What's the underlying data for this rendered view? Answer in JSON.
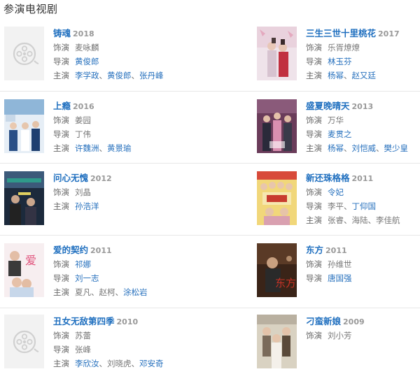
{
  "section_title": "参演电视剧",
  "labels": {
    "role": "饰演",
    "director": "导演",
    "starring": "主演"
  },
  "dramas": {
    "d0": {
      "title": "铸魂",
      "year": "2018",
      "role": [
        {
          "t": "麦咏麟",
          "l": false
        }
      ],
      "director": [
        {
          "t": "黄俊郎",
          "l": true
        }
      ],
      "starring": [
        {
          "t": "李学政",
          "l": true
        },
        {
          "t": "黄俊郎",
          "l": true
        },
        {
          "t": "张丹峰",
          "l": true
        }
      ]
    },
    "d1": {
      "title": "三生三世十里桃花",
      "year": "2017",
      "role": [
        {
          "t": "乐胥燎燎",
          "l": false
        }
      ],
      "director": [
        {
          "t": "林玉芬",
          "l": true
        }
      ],
      "starring": [
        {
          "t": "杨幂",
          "l": true
        },
        {
          "t": "赵又廷",
          "l": true
        }
      ]
    },
    "d2": {
      "title": "上瘾",
      "year": "2016",
      "role": [
        {
          "t": "姜园",
          "l": false
        }
      ],
      "director": [
        {
          "t": "丁伟",
          "l": false
        }
      ],
      "starring": [
        {
          "t": "许魏洲",
          "l": true
        },
        {
          "t": "黄景瑜",
          "l": true
        }
      ]
    },
    "d3": {
      "title": "盛夏晚晴天",
      "year": "2013",
      "role": [
        {
          "t": "万华",
          "l": false
        }
      ],
      "director": [
        {
          "t": "麦贯之",
          "l": true
        }
      ],
      "starring": [
        {
          "t": "杨幂",
          "l": true
        },
        {
          "t": "刘恺威",
          "l": true
        },
        {
          "t": "樊少皇",
          "l": true
        }
      ]
    },
    "d4": {
      "title": "问心无愧",
      "year": "2012",
      "role": [
        {
          "t": "刘晶",
          "l": false
        }
      ],
      "director": [],
      "starring": [
        {
          "t": "孙浩洋",
          "l": true
        }
      ]
    },
    "d5": {
      "title": "新还珠格格",
      "year": "2011",
      "role": [
        {
          "t": "令妃",
          "l": true
        }
      ],
      "director": [
        {
          "t": "李平",
          "l": false
        },
        {
          "t": "丁仰国",
          "l": true
        }
      ],
      "starring": [
        {
          "t": "张睿",
          "l": false
        },
        {
          "t": "海陆",
          "l": false
        },
        {
          "t": "李佳航",
          "l": false
        }
      ]
    },
    "d6": {
      "title": "爱的契约",
      "year": "2011",
      "role": [
        {
          "t": "祁娜",
          "l": true
        }
      ],
      "director": [
        {
          "t": "刘一志",
          "l": true
        }
      ],
      "starring": [
        {
          "t": "夏凡",
          "l": false
        },
        {
          "t": "赵柯",
          "l": false
        },
        {
          "t": "涂松岩",
          "l": true
        }
      ]
    },
    "d7": {
      "title": "东方",
      "year": "2011",
      "role": [
        {
          "t": "孙维世",
          "l": false
        }
      ],
      "director": [
        {
          "t": "唐国强",
          "l": true
        }
      ],
      "starring": []
    },
    "d8": {
      "title": "丑女无敌第四季",
      "year": "2010",
      "role": [
        {
          "t": "苏蕾",
          "l": false
        }
      ],
      "director": [
        {
          "t": "张峰",
          "l": false
        }
      ],
      "starring": [
        {
          "t": "李欣汝",
          "l": true
        },
        {
          "t": "刘晓虎",
          "l": false
        },
        {
          "t": "邓安奇",
          "l": true
        }
      ]
    },
    "d9": {
      "title": "刁蛮新娘",
      "year": "2009",
      "role": [
        {
          "t": "刘小芳",
          "l": false
        }
      ],
      "director": [],
      "starring": []
    }
  }
}
